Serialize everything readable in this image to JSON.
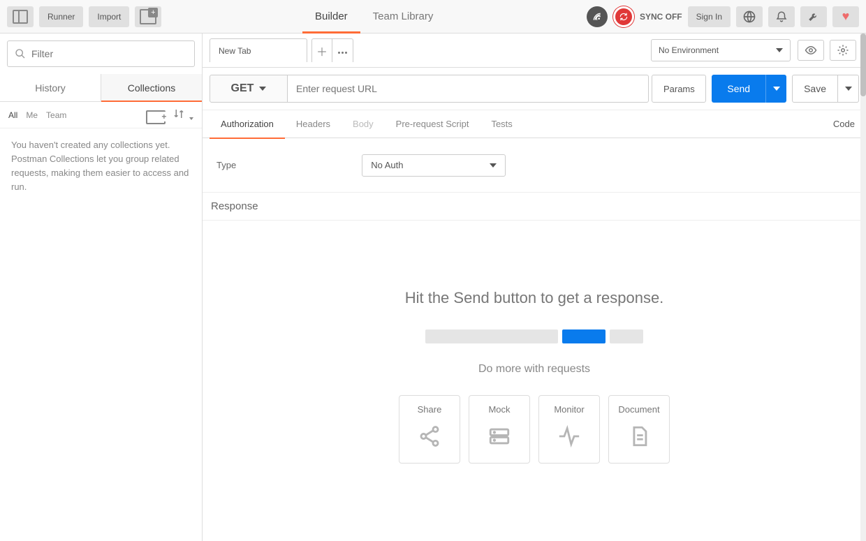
{
  "colors": {
    "accent": "#ff6c37",
    "primary_action": "#097bed",
    "sync_warning": "#e03838",
    "heart": "#ee6b6b"
  },
  "top_header": {
    "runner_label": "Runner",
    "import_label": "Import",
    "nav_tabs": [
      {
        "label": "Builder",
        "active": true
      },
      {
        "label": "Team Library",
        "active": false
      }
    ],
    "sync_label": "SYNC OFF",
    "sign_in_label": "Sign In"
  },
  "sidebar": {
    "filter_placeholder": "Filter",
    "tabs": [
      {
        "label": "History",
        "active": false
      },
      {
        "label": "Collections",
        "active": true
      }
    ],
    "scope_filters": [
      {
        "label": "All",
        "active": true
      },
      {
        "label": "Me",
        "active": false
      },
      {
        "label": "Team",
        "active": false
      }
    ],
    "empty_message": "You haven't created any collections yet. Postman Collections let you group related requests, making them easier to access and run."
  },
  "workspace": {
    "tabs": [
      {
        "label": "New Tab",
        "active": true
      }
    ],
    "environment": {
      "selected": "No Environment"
    },
    "request": {
      "method": "GET",
      "url_placeholder": "Enter request URL",
      "url_value": "",
      "params_label": "Params",
      "send_label": "Send",
      "save_label": "Save"
    },
    "request_subtabs": [
      {
        "label": "Authorization",
        "active": true,
        "disabled": false
      },
      {
        "label": "Headers",
        "active": false,
        "disabled": false
      },
      {
        "label": "Body",
        "active": false,
        "disabled": true
      },
      {
        "label": "Pre-request Script",
        "active": false,
        "disabled": false
      },
      {
        "label": "Tests",
        "active": false,
        "disabled": false
      }
    ],
    "code_link_label": "Code",
    "authorization": {
      "type_label": "Type",
      "selected_type": "No Auth"
    },
    "response": {
      "section_title": "Response",
      "empty_heading": "Hit the Send button to get a response.",
      "do_more_label": "Do more with requests",
      "cards": [
        {
          "key": "share",
          "label": "Share"
        },
        {
          "key": "mock",
          "label": "Mock"
        },
        {
          "key": "monitor",
          "label": "Monitor"
        },
        {
          "key": "document",
          "label": "Document"
        }
      ]
    }
  }
}
